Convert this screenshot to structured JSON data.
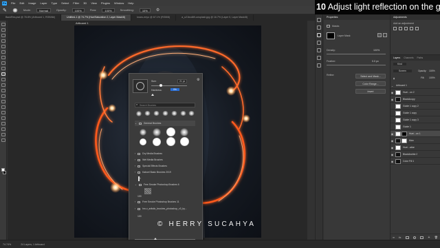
{
  "menubar": {
    "logo": "Ps",
    "items": [
      "File",
      "Edit",
      "Image",
      "Layer",
      "Type",
      "Select",
      "Filter",
      "3D",
      "View",
      "Plugins",
      "Window",
      "Help"
    ]
  },
  "options": {
    "mode_label": "Mode:",
    "mode_value": "Normal",
    "opacity_label": "Opacity:",
    "opacity_value": "100%",
    "flow_label": "Flow:",
    "flow_value": "100%",
    "smoothing_label": "Smoothing:",
    "smoothing_value": "10%"
  },
  "tabs": [
    "BackRes.psd @ 78.8% (Artboard 1, RGB/8#)",
    "Untitled-1 @ 74.7% (Hue/Saturation 2, Layer Mask/8)",
    "knaru-eeyo @ 67.1% (RGB/8)",
    "a_u21bcd89-unsplash.jpg @ 16.7% (Layer 0, Layer Mask/8)"
  ],
  "artboard": {
    "label": "Artboard 1"
  },
  "brush_panel": {
    "size_label": "Size:",
    "size_value": "21 px",
    "hardness_label": "Hardness:",
    "hardness_value": "0%",
    "search_placeholder": "Search Brushes",
    "folders": [
      "General Brushes",
      "Dry Media Brushes",
      "Wet Media Brushes",
      "Special Effects Brushes",
      "Kaboel Basic Brushes 2019",
      "Free Smoke Photoshop Brushes 6",
      "Free Smoke Photoshop Brushes 11",
      "hm-v_artistic_brushes_photoshop_v3_by..."
    ],
    "preset_sizes": [
      "1",
      "100"
    ],
    "footer_size": "100"
  },
  "properties": {
    "title": "Properties",
    "section": "Masks",
    "mask_label": "Layer Mask",
    "density_label": "Density:",
    "density_value": "100%",
    "feather_label": "Feather:",
    "feather_value": "0.0 px",
    "refine_label": "Refine:",
    "buttons": [
      "Select and Mask...",
      "Color Range...",
      "Invert"
    ]
  },
  "adjustments": {
    "title": "Adjustments",
    "subtitle": "Add an adjustment"
  },
  "layers": {
    "tabs": [
      "Layers",
      "Channels",
      "Paths"
    ],
    "kind_label": "Kind",
    "blend_mode": "Screen",
    "opacity_label": "Opacity:",
    "opacity_value": "100%",
    "fill_label": "Fill:",
    "fill_value": "100%",
    "artboard_label": "Artboard 1",
    "items": [
      {
        "name": "Hue/...on 2",
        "thumb": "white"
      },
      {
        "name": "Black&copy",
        "thumb": "dark"
      },
      {
        "name": "Guide 1 copy 2",
        "thumb": "white"
      },
      {
        "name": "Guide 1 copy",
        "thumb": "white"
      },
      {
        "name": "Guide 1 copy 3",
        "thumb": "white"
      },
      {
        "name": "Guide 1",
        "thumb": "white"
      },
      {
        "name": "Hue/...on 1",
        "thumb": "mask"
      },
      {
        "name": "Man",
        "thumb": "dark"
      },
      {
        "name": "Hue/...ation",
        "thumb": "white"
      },
      {
        "name": "Black&white 2",
        "thumb": "dark"
      },
      {
        "name": "Color Fill 1",
        "thumb": "dark"
      }
    ]
  },
  "status": {
    "zoom": "74.74%",
    "doc": "24 Layers, 1 Artboard"
  },
  "overlay": {
    "step_number": "10",
    "title": "Adjust light reflection on the guy"
  },
  "watermark": "© HERRY SUCAHYA"
}
